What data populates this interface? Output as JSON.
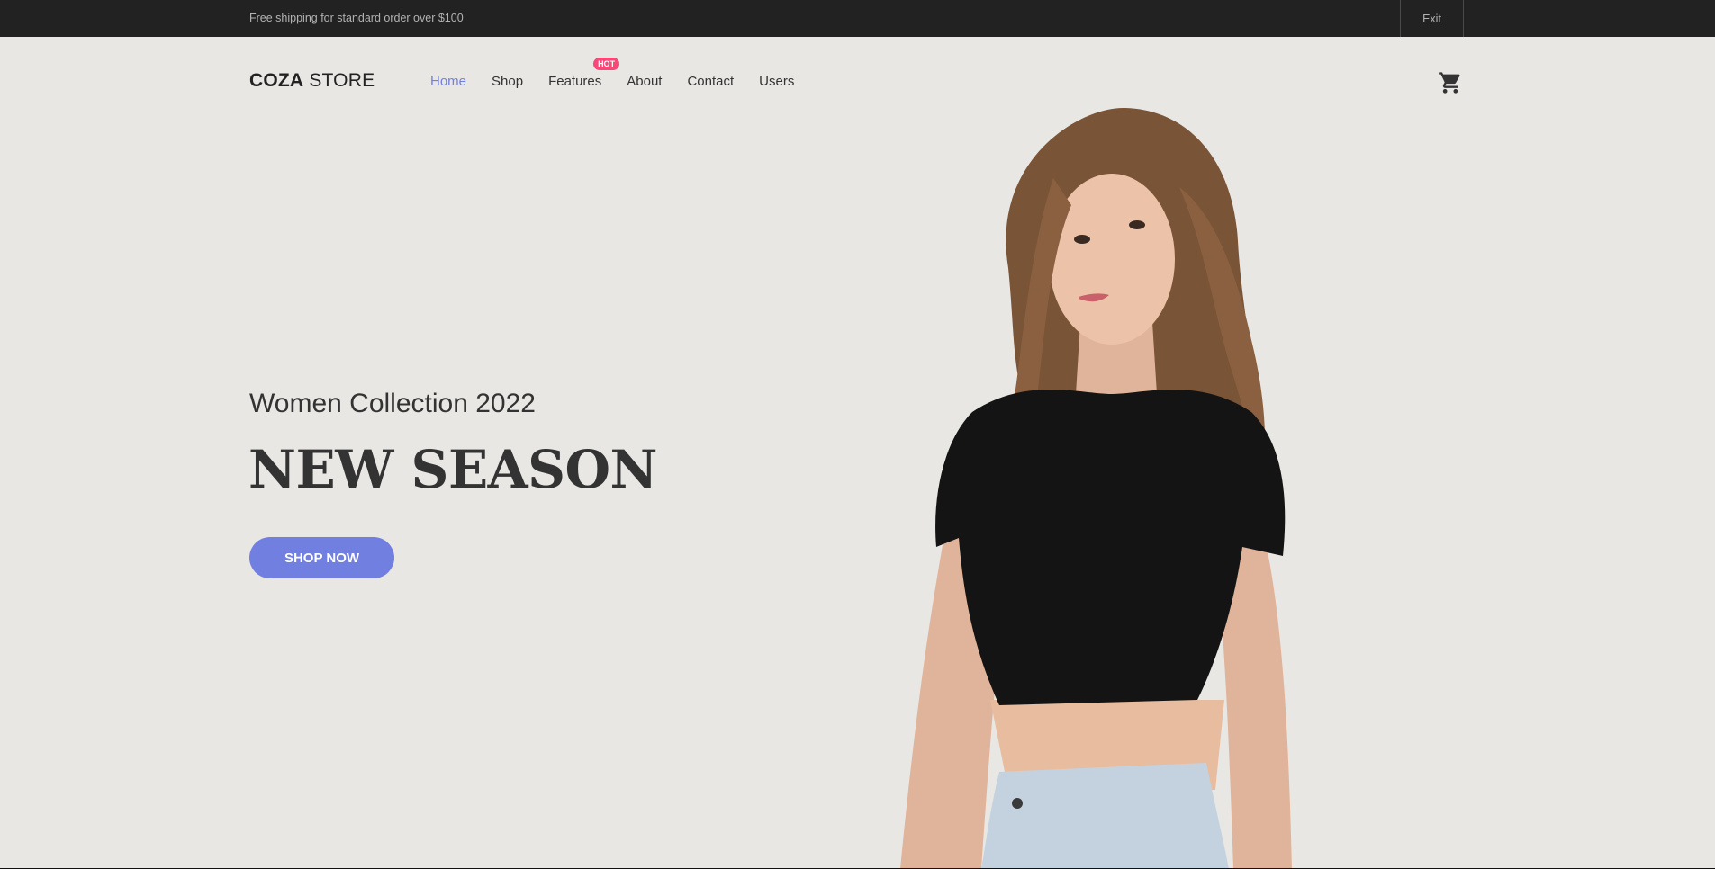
{
  "topbar": {
    "shipping_text": "Free shipping for standard order over $100",
    "exit_label": "Exit"
  },
  "header": {
    "logo_bold": "COZA",
    "logo_regular": " STORE",
    "nav": [
      {
        "label": "Home",
        "active": true
      },
      {
        "label": "Shop",
        "active": false
      },
      {
        "label": "Features",
        "active": false,
        "badge": "HOT"
      },
      {
        "label": "About",
        "active": false
      },
      {
        "label": "Contact",
        "active": false
      },
      {
        "label": "Users",
        "active": false
      }
    ],
    "cart_icon": "shopping-cart-icon"
  },
  "hero": {
    "subtitle": "Women Collection 2022",
    "headline": "NEW SEASON",
    "cta_label": "SHOP NOW"
  },
  "colors": {
    "accent": "#717fe0",
    "hot_badge": "#f74877",
    "topbar_bg": "#222222",
    "hero_bg": "#e9e7e4"
  }
}
